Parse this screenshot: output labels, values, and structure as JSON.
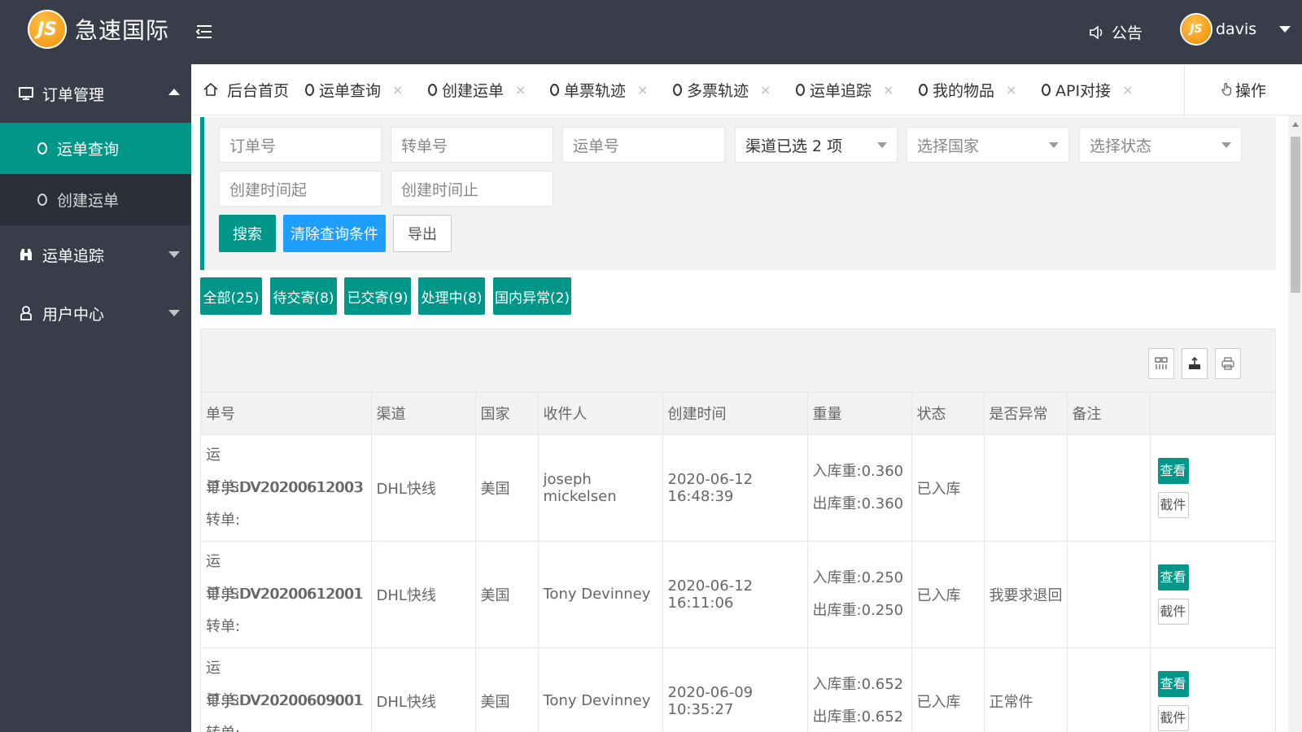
{
  "app": {
    "logo_badge": "JS",
    "brand": "急速国际",
    "notice": "公告",
    "avatar_badge": "JS",
    "user": "davis"
  },
  "sidebar": {
    "groups": [
      {
        "label": "订单管理",
        "icon": "monitor-icon",
        "expanded": true,
        "items": [
          {
            "label": "运单查询",
            "active": true
          },
          {
            "label": "创建运单",
            "active": false
          }
        ]
      },
      {
        "label": "运单追踪",
        "icon": "binoculars-icon",
        "expanded": false
      },
      {
        "label": "用户中心",
        "icon": "user-icon",
        "expanded": false
      }
    ]
  },
  "tabs": {
    "home": "后台首页",
    "items": [
      "运单查询",
      "创建运单",
      "单票轨迹",
      "多票轨迹",
      "运单追踪",
      "我的物品",
      "API对接"
    ],
    "close": "×",
    "ops": "操作"
  },
  "filters": {
    "order_no": "订单号",
    "transfer_no": "转单号",
    "waybill_no": "运单号",
    "channel": "渠道已选 2 项",
    "country": "选择国家",
    "status": "选择状态",
    "created_from": "创建时间起",
    "created_to": "创建时间止",
    "search": "搜索",
    "clear": "清除查询条件",
    "export": "导出"
  },
  "status_tabs": [
    "全部(25)",
    "待交寄(8)",
    "已交寄(9)",
    "处理中(8)",
    "国内异常(2)"
  ],
  "table": {
    "columns": [
      "单号",
      "渠道",
      "国家",
      "收件人",
      "创建时间",
      "重量",
      "状态",
      "是否异常",
      "备注",
      ""
    ],
    "rows": [
      {
        "waybill": "运单:JSDV20200612003",
        "order": "订单:DV20200612003",
        "transfer": "转单:",
        "channel": "DHL快线",
        "country": "美国",
        "recipient": "joseph mickelsen",
        "created": "2020-06-12 16:48:39",
        "weight_in": "入库重:0.360",
        "weight_out": "出库重:0.360",
        "status": "已入库",
        "abnormal": "",
        "remark": ""
      },
      {
        "waybill": "运单:JSDV20200612001",
        "order": "订单:DV20200612001",
        "transfer": "转单:",
        "channel": "DHL快线",
        "country": "美国",
        "recipient": "Tony Devinney",
        "created": "2020-06-12 16:11:06",
        "weight_in": "入库重:0.250",
        "weight_out": "出库重:0.250",
        "status": "已入库",
        "abnormal": "我要求退回",
        "remark": ""
      },
      {
        "waybill": "运单:JSDV20200609001",
        "order": "订单:DV20200609001",
        "transfer": "转单:",
        "channel": "DHL快线",
        "country": "美国",
        "recipient": "Tony Devinney",
        "created": "2020-06-09 10:35:27",
        "weight_in": "入库重:0.652",
        "weight_out": "出库重:0.652",
        "status": "已入库",
        "abnormal": "正常件",
        "remark": ""
      }
    ],
    "actions": {
      "view": "查看",
      "label": "截件"
    }
  },
  "colors": {
    "header_bg": "#393d49",
    "accent_teal": "#009688",
    "accent_blue": "#1e9fff"
  }
}
